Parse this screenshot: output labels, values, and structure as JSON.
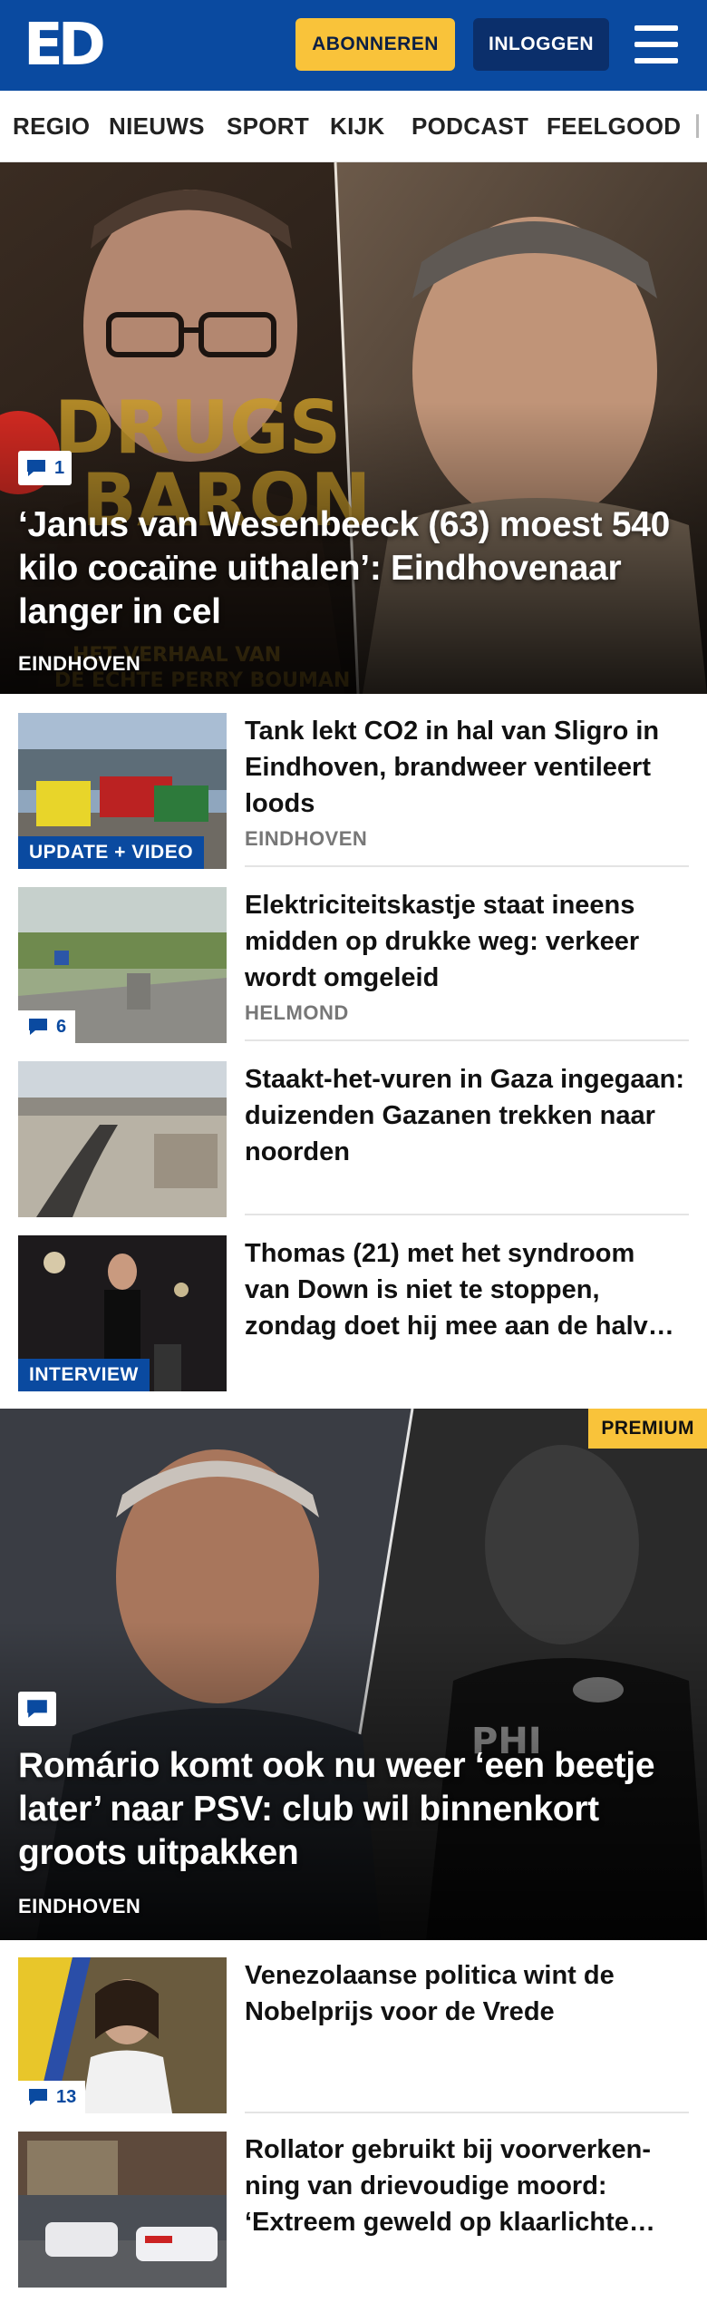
{
  "header": {
    "logo_text": "ED",
    "subscribe_label": "ABONNEREN",
    "login_label": "INLOGGEN",
    "colors": {
      "brand": "#0a4aa0",
      "accent": "#f9c33a",
      "login_bg": "#0b2f6b"
    }
  },
  "nav": {
    "items": [
      "REGIO",
      "NIEUWS",
      "SPORT",
      "KIJK",
      "PODCAST",
      "FEELGOOD"
    ]
  },
  "hero1": {
    "comment_count": "1",
    "title": "‘Janus van Wesenbeeck (63) moest 540 kilo cocaïne uithalen’: Eindho­venaar langer in cel",
    "section": "EINDHOVEN",
    "icon": "comment-icon"
  },
  "articles1": [
    {
      "title": "Tank lekt CO2 in hal van Sligro in Eindhoven, brandweer ventileert loods",
      "section": "EINDHOVEN",
      "tag": "UPDATE + VIDEO"
    },
    {
      "title": "Elektriciteitskastje staat ineens midden op drukke weg: verkeer wordt omgeleid",
      "section": "HELMOND",
      "comment_count": "6"
    },
    {
      "title": "Staakt-het-vuren in Gaza ingegaan: duizenden Gazanen trekken naar noorden"
    },
    {
      "title": "Thomas (21) met het syndroom van Down is niet te stoppen, zondag doet hij mee aan de halve marathon",
      "tag": "INTERVIEW"
    }
  ],
  "hero2": {
    "badge": "PREMIUM",
    "title": "Romário komt ook nu weer ‘een beetje later’ naar PSV: club wil binnenkort groots uitpakken",
    "section": "EINDHOVEN",
    "icon": "comment-icon"
  },
  "articles2": [
    {
      "title": "Venezolaanse politica wint de Nobelprijs voor de Vrede",
      "comment_count": "13"
    },
    {
      "title": "Rollator gebruikt bij voorverken­ning van drievoudige moord: ‘Extreem geweld op klaarlichte dag’"
    }
  ]
}
